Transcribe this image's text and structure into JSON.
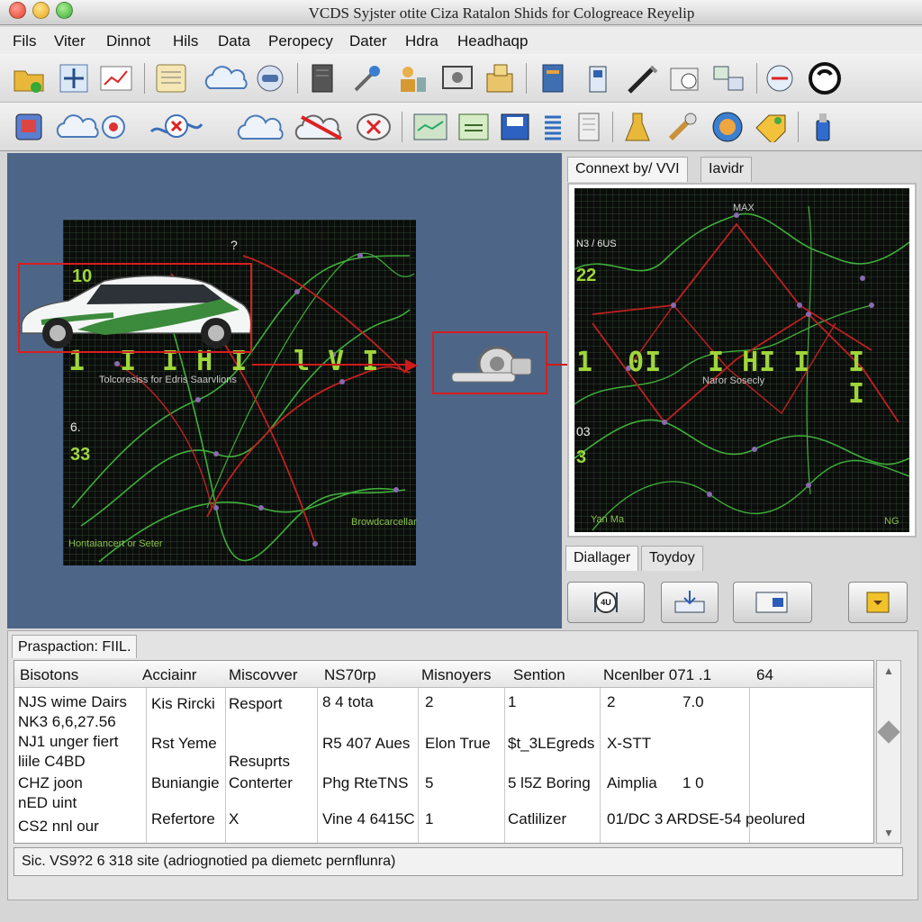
{
  "window": {
    "title": "VCDS Syjster otite Ciza Ratalon Shids for Cologreace Reyelip"
  },
  "menu": [
    "Fils",
    "Viter",
    "Dinnot",
    "Hils",
    "Data",
    "Peropecy",
    "Dater",
    "Hdra",
    "Headhaqp"
  ],
  "toolbar1_icons": [
    "folder-icon",
    "add-icon",
    "chart-icon",
    "calendar-icon",
    "cloud-icon",
    "car-icon",
    "binder-icon",
    "tools-icon",
    "person-icon",
    "monitor-icon",
    "box-icon",
    "server-icon",
    "battery-icon",
    "pen-icon",
    "meter-icon",
    "network-icon",
    "diagnostics-icon",
    "power-icon"
  ],
  "toolbar2_icons": [
    "module-icon",
    "cloud-connect-icon",
    "error-icon",
    "cloud-sync-icon",
    "no-connection-icon",
    "cancel-icon",
    "graph-icon",
    "check-sheet-icon",
    "save-icon",
    "spring-icon",
    "documents-icon",
    "flask-icon",
    "wrench-icon",
    "globe-icon",
    "tag-icon",
    "usb-icon"
  ],
  "left_graph": {
    "digits": [
      "1  I",
      "I H I",
      "l V I"
    ],
    "subtitle": "Tolcoresiss for Edris Saarvlions",
    "top_num": "10",
    "marker": "?",
    "left_label": "6.",
    "left_num": "33",
    "footer": "Hontaiancert or Seter",
    "corner_label": "Browdcarcellar"
  },
  "right_tabs": {
    "tab1": "Connext by/ VVI",
    "tab2": "Iavidr"
  },
  "right_graph": {
    "top_label": "MAX",
    "left_label": "N3 / 6US",
    "num1": "22",
    "digits": [
      "1  0I",
      "I HI I",
      "I  I"
    ],
    "subtitle": "Naror Sosecly",
    "left_small": "03",
    "num2": "3",
    "corner": "Yan Ma",
    "corner2": "NG"
  },
  "dialog_tabs": {
    "tab1": "Diallager",
    "tab2": "Toydoy"
  },
  "dialog_buttons": [
    {
      "name": "dial-button",
      "label": "4U"
    },
    {
      "name": "download-button",
      "label": ""
    },
    {
      "name": "window-button",
      "label": ""
    },
    {
      "name": "folder-button",
      "label": ""
    }
  ],
  "bottom": {
    "tab": "Praspaction: FIIL.",
    "headers": [
      "Bisotons",
      "Acciainr",
      "Miscovver",
      "NS70rp",
      "Misnoyers",
      "Sention",
      "Ncenlber 071 .1",
      "64"
    ],
    "col1": [
      "NJS wime Dairs",
      "NK3 6,6,27.56",
      "NJ1 unger fiert",
      "liile C4BD",
      "CHZ joon",
      "nED uint",
      "CS2 nnl our"
    ],
    "col2": [
      "Kis Rircki",
      "Rst Yeme",
      "Buniangie",
      "Refertore"
    ],
    "col3": [
      "Resport",
      "Resuprts",
      "Conterter",
      "X"
    ],
    "col4": [
      "8 4 tota",
      "R5 407 Aues",
      "Phg RteTNS",
      "Vine 4 6415C"
    ],
    "col5": [
      "2",
      "Elon True",
      "5",
      "1"
    ],
    "col6": [
      "1",
      "$t_3LEgreds",
      "5 l5Z Boring",
      "Catlilizer"
    ],
    "col7": [
      "2",
      "X-STT",
      "Aimplia",
      "01/DC 3 ARDSE-54 peolured"
    ],
    "col7b": [
      "7.0",
      "1 0"
    ],
    "status": "Sic. VS9?2 6 318 site (adriognotied pa diemetc pernflunra)"
  },
  "colors": {
    "accent_red": "#d91e1e",
    "graph_green": "#9fd63a",
    "pane_blue": "#4d6688"
  }
}
